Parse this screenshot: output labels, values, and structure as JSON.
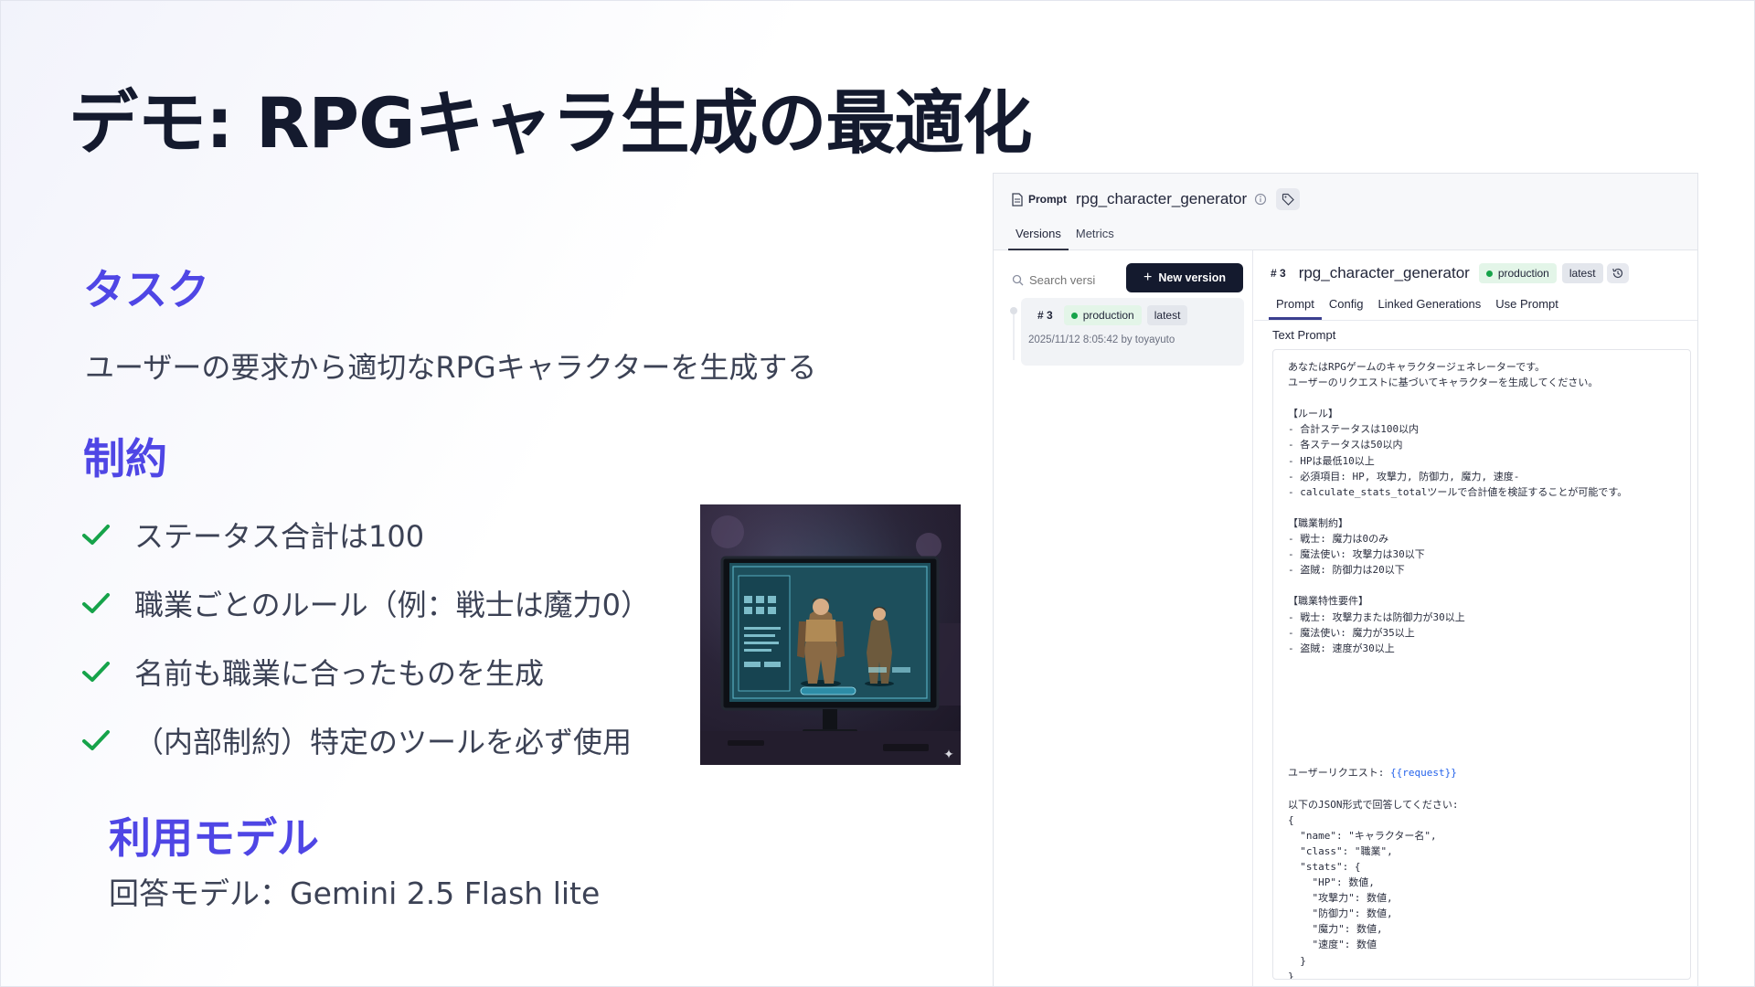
{
  "slide": {
    "title": "デモ: RPGキャラ生成の最適化",
    "task_heading": "タスク",
    "task_text": "ユーザーの要求から適切なRPGキャラクターを生成する",
    "constraints_heading": "制約",
    "constraints": [
      "ステータス合計は100",
      "職業ごとのルール（例：戦士は魔力0）",
      "名前も職業に合ったものを生成",
      "（内部制約）特定のツールを必ず使用"
    ],
    "model_heading": "利用モデル",
    "model_text": "回答モデル：Gemini 2.5 Flash lite",
    "accent_color": "#4f46e5",
    "check_color": "#16a34a"
  },
  "panel": {
    "kind_label": "Prompt",
    "prompt_name": "rpg_character_generator",
    "tabs": [
      "Versions",
      "Metrics"
    ],
    "active_tab": "Versions",
    "search_placeholder": "Search versi",
    "new_version_label": "New version",
    "version_card": {
      "number": "# 3",
      "badge_production": "production",
      "badge_latest": "latest",
      "meta": "2025/11/12 8:05:42 by toyayuto"
    },
    "detail": {
      "number": "# 3",
      "name": "rpg_character_generator",
      "badge_production": "production",
      "badge_latest": "latest",
      "tabs": [
        "Prompt",
        "Config",
        "Linked Generations",
        "Use Prompt"
      ],
      "active_tab": "Prompt",
      "section_label": "Text Prompt",
      "prompt_lines": [
        "あなたはRPGゲームのキャラクタージェネレーターです。",
        "ユーザーのリクエストに基づいてキャラクターを生成してください。",
        "",
        "【ルール】",
        "- 合計ステータスは100以内",
        "- 各ステータスは50以内",
        "- HPは最低10以上",
        "- 必須項目: HP, 攻撃力, 防御力, 魔力, 速度-",
        "- calculate_stats_totalツールで合計値を検証することが可能です。",
        "",
        "【職業制約】",
        "- 戦士: 魔力は0のみ",
        "- 魔法使い: 攻撃力は30以下",
        "- 盗賊: 防御力は20以下",
        "",
        "【職業特性要件】",
        "- 戦士: 攻撃力または防御力が30以上",
        "- 魔法使い: 魔力が35以上",
        "- 盗賊: 速度が30以上",
        "",
        "",
        "",
        "",
        "",
        "",
        "",
        "ユーザーリクエスト: ",
        "",
        "以下のJSON形式で回答してください:",
        "{",
        "  \"name\": \"キャラクター名\",",
        "  \"class\": \"職業\",",
        "  \"stats\": {",
        "    \"HP\": 数値,",
        "    \"攻撃力\": 数値,",
        "    \"防御力\": 数値,",
        "    \"魔力\": 数値,",
        "    \"速度\": 数値",
        "  }",
        "}"
      ],
      "request_variable": "{{request}}"
    }
  }
}
